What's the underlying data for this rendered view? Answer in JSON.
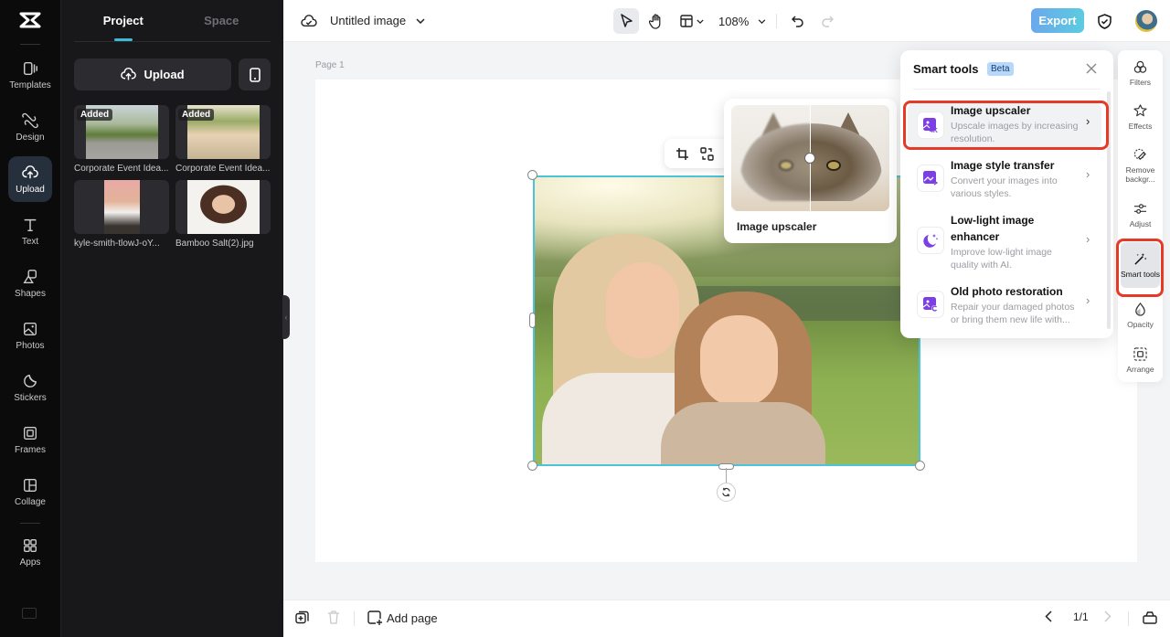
{
  "rail": {
    "logo": "capcut-logo",
    "items": [
      {
        "label": "Templates",
        "icon": "templates-icon"
      },
      {
        "label": "Design",
        "icon": "design-icon"
      },
      {
        "label": "Upload",
        "icon": "upload-cloud-icon",
        "active": true
      },
      {
        "label": "Text",
        "icon": "text-icon"
      },
      {
        "label": "Shapes",
        "icon": "shapes-icon"
      },
      {
        "label": "Photos",
        "icon": "photos-icon"
      },
      {
        "label": "Stickers",
        "icon": "stickers-icon"
      },
      {
        "label": "Frames",
        "icon": "frames-icon"
      },
      {
        "label": "Collage",
        "icon": "collage-icon"
      },
      {
        "label": "Apps",
        "icon": "apps-icon"
      }
    ]
  },
  "panel": {
    "tabs": [
      {
        "label": "Project",
        "active": true
      },
      {
        "label": "Space"
      }
    ],
    "upload_label": "Upload",
    "assets": [
      {
        "name": "Corporate Event Idea...",
        "badge": "Added"
      },
      {
        "name": "Corporate Event Idea...",
        "badge": "Added"
      },
      {
        "name": "kyle-smith-tlowJ-oY...",
        "badge": ""
      },
      {
        "name": "Bamboo Salt(2).jpg",
        "badge": ""
      }
    ]
  },
  "topbar": {
    "title": "Untitled image",
    "zoom": "108%",
    "export_label": "Export"
  },
  "canvas": {
    "page_label": "Page 1"
  },
  "preview": {
    "label": "Image upscaler"
  },
  "smart_tools": {
    "title": "Smart tools",
    "badge": "Beta",
    "items": [
      {
        "name": "Image upscaler",
        "desc": "Upscale images by increasing resolution.",
        "icon": "upscale-4k-icon",
        "highlighted": true
      },
      {
        "name": "Image style transfer",
        "desc": "Convert your images into various styles.",
        "icon": "style-transfer-icon"
      },
      {
        "name": "Low-light image enhancer",
        "desc": "Improve low-light image quality with AI.",
        "icon": "moon-sparkle-icon"
      },
      {
        "name": "Old photo restoration",
        "desc": "Repair your damaged photos or bring them new life with...",
        "icon": "photo-restore-icon"
      }
    ]
  },
  "tool_rail": {
    "items": [
      {
        "label": "Filters"
      },
      {
        "label": "Effects"
      },
      {
        "label": "Remove backgr..."
      },
      {
        "label": "Adjust"
      },
      {
        "label": "Smart tools",
        "active": true
      },
      {
        "label": "Opacity"
      },
      {
        "label": "Arrange"
      }
    ]
  },
  "bottombar": {
    "add_page": "Add page",
    "page_count": "1/1"
  },
  "colors": {
    "accent": "#4cc3d9",
    "highlight_box": "#e53a27",
    "purple_icon": "#7b3fe4",
    "export_gradient_start": "#6ba8ec",
    "export_gradient_end": "#5ccbe0"
  }
}
